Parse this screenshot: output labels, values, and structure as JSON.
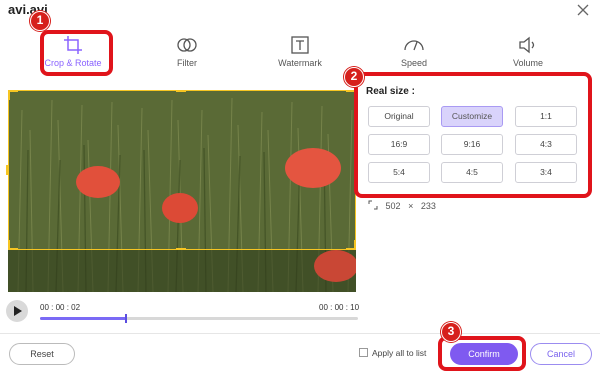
{
  "window": {
    "title": "avi.avi"
  },
  "tabs": [
    {
      "label": "Crop & Rotate",
      "icon": "crop-icon",
      "active": true
    },
    {
      "label": "Filter",
      "icon": "filter-icon"
    },
    {
      "label": "Watermark",
      "icon": "watermark-icon"
    },
    {
      "label": "Speed",
      "icon": "speed-icon"
    },
    {
      "label": "Volume",
      "icon": "volume-icon"
    }
  ],
  "annotations": {
    "one": "1",
    "two": "2",
    "three": "3"
  },
  "player": {
    "current_time": "00 : 00 : 02",
    "total_time": "00 : 00 : 10",
    "progress": 0.27
  },
  "real_size": {
    "label": "Real size :",
    "options": [
      "Original",
      "Customize",
      "1:1",
      "16:9",
      "9:16",
      "4:3",
      "5:4",
      "4:5",
      "3:4"
    ],
    "selected": "Customize"
  },
  "dimensions": {
    "width": "502",
    "separator": "×",
    "height": "233"
  },
  "footer": {
    "reset": "Reset",
    "apply_all": "Apply all to list",
    "confirm": "Confirm",
    "cancel": "Cancel"
  },
  "colors": {
    "accent": "#7f5af0",
    "annotation": "#e0141b",
    "crop_frame": "#f6c522"
  }
}
